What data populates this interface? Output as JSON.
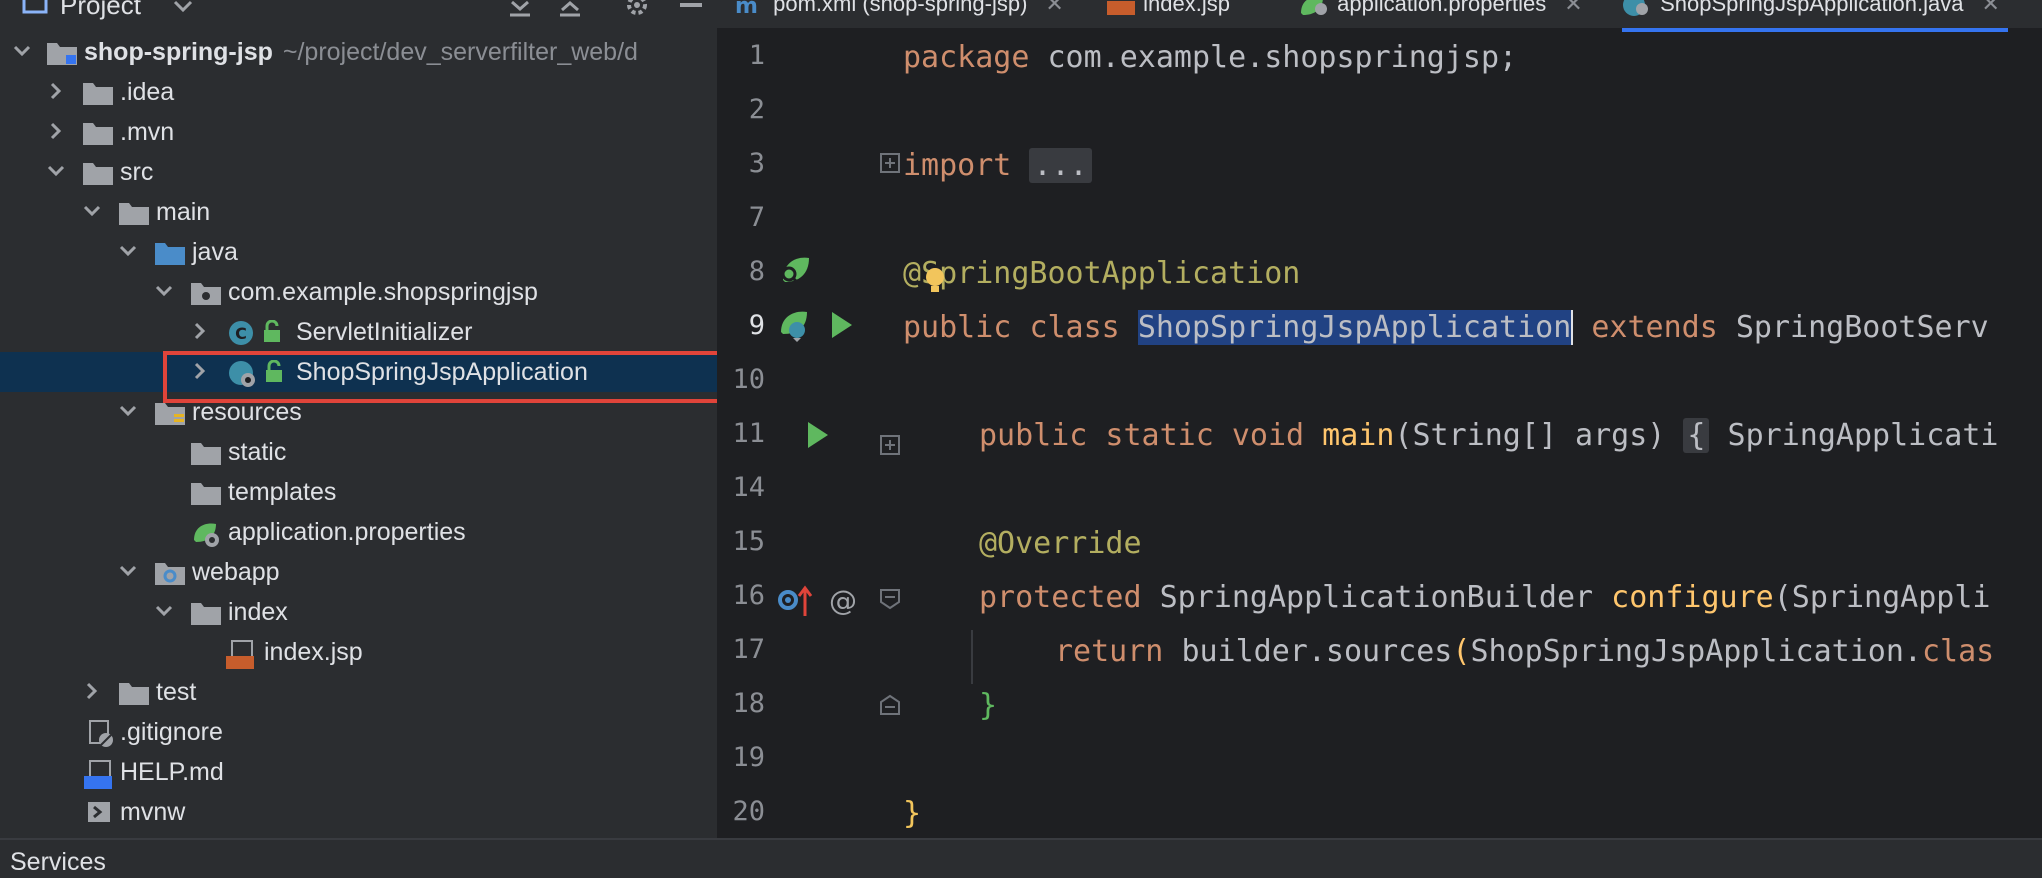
{
  "project_panel": {
    "title": "Project",
    "tree": [
      {
        "label": "shop-spring-jsp",
        "path": "~/project/dev_serverfilter_web/d",
        "icon": "module-folder-icon",
        "expanded": true
      },
      {
        "label": ".idea",
        "icon": "folder-icon"
      },
      {
        "label": ".mvn",
        "icon": "folder-icon"
      },
      {
        "label": "src",
        "icon": "folder-icon"
      },
      {
        "label": "main",
        "icon": "folder-icon"
      },
      {
        "label": "java",
        "icon": "source-folder-icon"
      },
      {
        "label": "com.example.shopspringjsp",
        "icon": "package-icon"
      },
      {
        "label": "ServletInitializer",
        "icon": "class-icon"
      },
      {
        "label": "ShopSpringJspApplication",
        "icon": "spring-boot-class-icon"
      },
      {
        "label": "resources",
        "icon": "resources-folder-icon"
      },
      {
        "label": "static",
        "icon": "folder-icon"
      },
      {
        "label": "templates",
        "icon": "folder-icon"
      },
      {
        "label": "application.properties",
        "icon": "spring-properties-icon"
      },
      {
        "label": "webapp",
        "icon": "webapp-folder-icon"
      },
      {
        "label": "index",
        "icon": "folder-icon"
      },
      {
        "label": "index.jsp",
        "icon": "jsp-file-icon"
      },
      {
        "label": "test",
        "icon": "folder-icon"
      },
      {
        "label": ".gitignore",
        "icon": "gitignore-icon"
      },
      {
        "label": "HELP.md",
        "icon": "markdown-icon"
      },
      {
        "label": "mvnw",
        "icon": "script-icon"
      }
    ]
  },
  "tabs": [
    {
      "label": "pom.xml (shop-spring-jsp)",
      "icon": "maven-icon"
    },
    {
      "label": "index.jsp",
      "icon": "jsp-file-icon"
    },
    {
      "label": "application.properties",
      "icon": "spring-properties-icon"
    },
    {
      "label": "ShopSpringJspApplication.java",
      "icon": "spring-boot-class-icon",
      "active": true
    }
  ],
  "editor": {
    "line_numbers": [
      "1",
      "2",
      "3",
      "7",
      "8",
      "9",
      "10",
      "11",
      "14",
      "15",
      "16",
      "17",
      "18",
      "19",
      "20"
    ],
    "code": {
      "l1_kw": "package",
      "l1_rest": " com.example.shopspringjsp;",
      "l3_kw": "import",
      "l3_fold": "...",
      "l8_at": "@",
      "l8_rest": "SpringBootApplication",
      "l9_kw1": "public",
      "l9_kw2": "class",
      "l9_sel": "ShopSpringJspApplication",
      "l9_kw3": "extends",
      "l9_rest": "SpringBootServ",
      "l11_kw": "public static void",
      "l11_mth": "main",
      "l11_args": "(String[] args)",
      "l11_fold": "{",
      "l11_rest": "SpringApplicati",
      "l15_ann": "@Override",
      "l16_kw": "protected",
      "l16_type": "SpringApplicationBuilder",
      "l16_mth": "configure",
      "l16_rest": "(SpringAppli",
      "l17_kw": "return",
      "l17_rest": "builder.sources",
      "l17_paren": "(",
      "l17_cls": "ShopSpringJspApplication.",
      "l17_tail": "clas",
      "l18": "}",
      "l20": "}"
    }
  },
  "bottom_bar": {
    "label": "Services"
  },
  "colors": {
    "keyword": "#cf8e6d",
    "annotation": "#b3ae60",
    "selection": "#214283",
    "highlight_box": "#e0443a",
    "tree_selection": "#0e3150"
  }
}
